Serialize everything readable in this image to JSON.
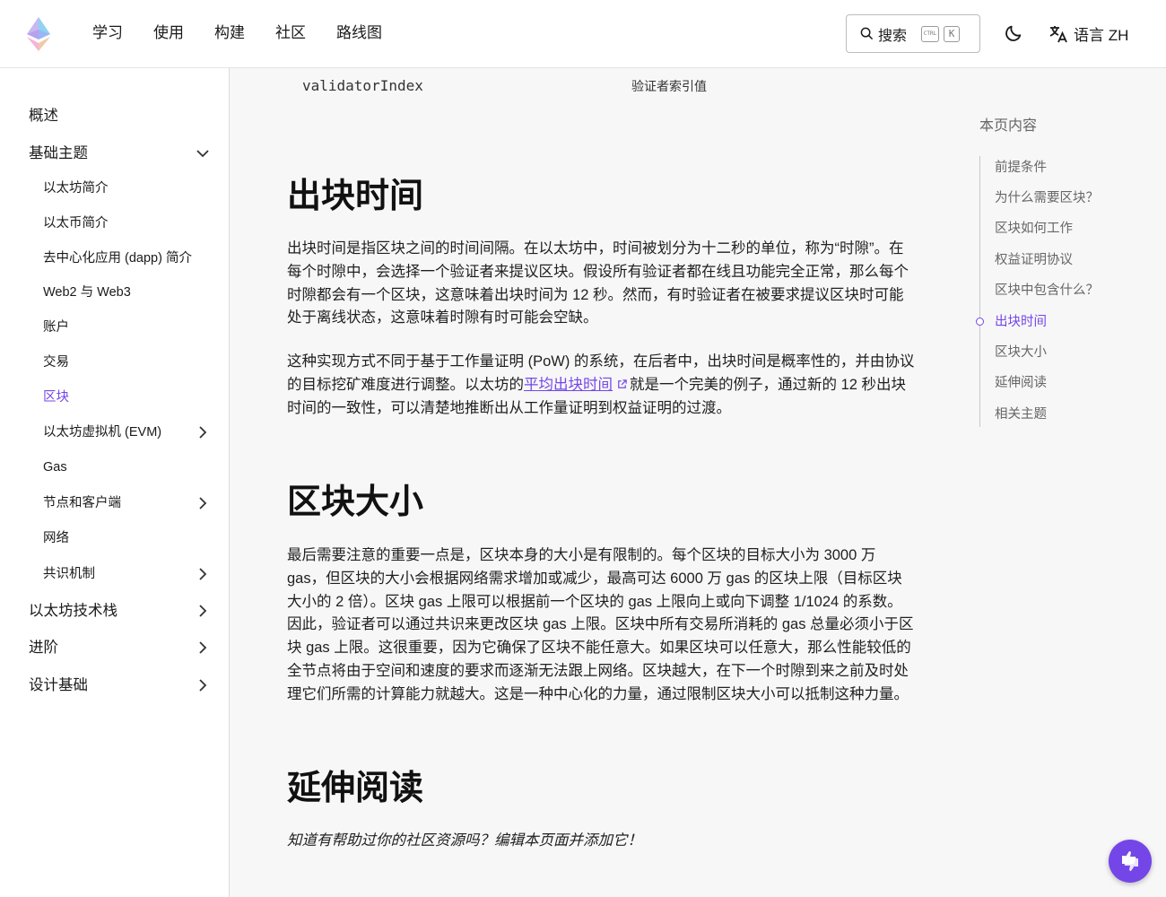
{
  "nav": {
    "items": [
      "学习",
      "使用",
      "构建",
      "社区",
      "路线图"
    ]
  },
  "search": {
    "label": "搜索",
    "kbd_ctrl": "CTRL",
    "kbd_k": "K"
  },
  "language": {
    "label": "语言 ZH"
  },
  "sidebar": {
    "items": [
      {
        "label": "概述",
        "level": "top",
        "expandable": false
      },
      {
        "label": "基础主题",
        "level": "top",
        "expandable": true,
        "expanded": true
      },
      {
        "label": "以太坊简介",
        "level": "sub"
      },
      {
        "label": "以太币简介",
        "level": "sub"
      },
      {
        "label": "去中心化应用 (dapp) 简介",
        "level": "sub"
      },
      {
        "label": "Web2 与 Web3",
        "level": "sub"
      },
      {
        "label": "账户",
        "level": "sub"
      },
      {
        "label": "交易",
        "level": "sub"
      },
      {
        "label": "区块",
        "level": "sub",
        "active": true
      },
      {
        "label": "以太坊虚拟机 (EVM)",
        "level": "sub",
        "expandable": true
      },
      {
        "label": "Gas",
        "level": "sub"
      },
      {
        "label": "节点和客户端",
        "level": "sub",
        "expandable": true
      },
      {
        "label": "网络",
        "level": "sub"
      },
      {
        "label": "共识机制",
        "level": "sub",
        "expandable": true
      },
      {
        "label": "以太坊技术栈",
        "level": "top",
        "expandable": true
      },
      {
        "label": "进阶",
        "level": "top",
        "expandable": true
      },
      {
        "label": "设计基础",
        "level": "top",
        "expandable": true
      }
    ]
  },
  "table_row": {
    "field": "validatorIndex",
    "description": "验证者索引值"
  },
  "sections": {
    "block_time": {
      "heading": "出块时间",
      "p1": "出块时间是指区块之间的时间间隔。在以太坊中，时间被划分为十二秒的单位，称为“时隙”。在每个时隙中，会选择一个验证者来提议区块。假设所有验证者都在线且功能完全正常，那么每个时隙都会有一个区块，这意味着出块时间为 12 秒。然而，有时验证者在被要求提议区块时可能处于离线状态，这意味着时隙有时可能会空缺。",
      "p2_before": "这种实现方式不同于基于工作量证明 (PoW) 的系统，在后者中，出块时间是概率性的，并由协议的目标挖矿难度进行调整。以太坊的",
      "p2_link": "平均出块时间",
      "p2_after": "就是一个完美的例子，通过新的 12 秒出块时间的一致性，可以清楚地推断出从工作量证明到权益证明的过渡。"
    },
    "block_size": {
      "heading": "区块大小",
      "p1": "最后需要注意的重要一点是，区块本身的大小是有限制的。每个区块的目标大小为 3000 万 gas，但区块的大小会根据网络需求增加或减少，最高可达 6000 万 gas 的区块上限（目标区块大小的 2 倍）。区块 gas 上限可以根据前一个区块的 gas 上限向上或向下调整 1/1024 的系数。因此，验证者可以通过共识来更改区块 gas 上限。区块中所有交易所消耗的 gas 总量必须小于区块 gas 上限。这很重要，因为它确保了区块不能任意大。如果区块可以任意大，那么性能较低的全节点将由于空间和速度的要求而逐渐无法跟上网络。区块越大，在下一个时隙到来之前及时处理它们所需的计算能力就越大。这是一种中心化的力量，通过限制区块大小可以抵制这种力量。"
    },
    "further_reading": {
      "heading": "延伸阅读",
      "p1": "知道有帮助过你的社区资源吗？编辑本页面并添加它！"
    }
  },
  "toc": {
    "title": "本页内容",
    "items": [
      "前提条件",
      "为什么需要区块？",
      "区块如何工作",
      "权益证明协议",
      "区块中包含什么？",
      "出块时间",
      "区块大小",
      "延伸阅读",
      "相关主题"
    ],
    "active": "出块时间"
  },
  "colors": {
    "accent": "#7446e8"
  }
}
